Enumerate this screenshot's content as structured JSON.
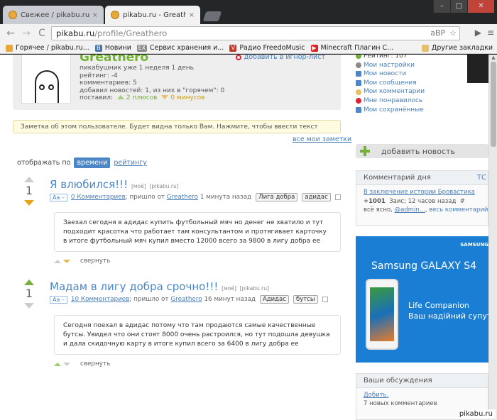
{
  "browser": {
    "tabs": [
      {
        "title": "Свежее / pikabu.ru - Все",
        "close": "×"
      },
      {
        "title": "pikabu.ru - Greathero",
        "close": "×"
      }
    ],
    "window_controls": {
      "minimize": "–",
      "maximize": "□",
      "close": "✕"
    },
    "url_host": "pikabu.ru",
    "url_path": "/profile/Greathero",
    "nav": {
      "back": "←",
      "forward": "→",
      "reload": "C"
    },
    "omni_icons": {
      "extension": "aBP",
      "star": "☆"
    },
    "toolbar_icons": {
      "extension": "▶",
      "menu": "≡"
    },
    "bookmarks": [
      {
        "label": "Горячее / pikabu.ru...",
        "icon": "pikabu-icon",
        "color": "#e8a93a",
        "glyph": ""
      },
      {
        "label": "Новини",
        "icon": "vk-icon",
        "color": "#4a76a8",
        "glyph": "B"
      },
      {
        "label": "Сервис хранения и...",
        "icon": "ex-icon",
        "color": "#8a8a8a",
        "glyph": "EX"
      },
      {
        "label": "Радио FreedoMusic",
        "icon": "radio-icon",
        "color": "#c0392b",
        "glyph": "V"
      },
      {
        "label": "Minecraft Плагин С...",
        "icon": "youtube-icon",
        "color": "#d22",
        "glyph": "▶"
      }
    ],
    "other_bookmarks": "Другие закладки"
  },
  "profile": {
    "username": "Greathero",
    "ignore_link": "добавить в игнор-лист",
    "stats": [
      "пикабушник уже 1 неделя 1 день",
      "рейтинг: -4",
      "комментариев: 5",
      "добавил новостей: 1, из них в \"горячем\": 0"
    ],
    "votes_label": "поставил:",
    "plus_votes": "2 плюсов",
    "minus_votes": "0 минусов"
  },
  "note": {
    "placeholder": "Заметка об этом пользователе. Будет видна только Вам. Нажмите, чтобы ввести текст",
    "all_notes": "все мои заметки"
  },
  "sort": {
    "label": "отображать по",
    "active": "времени",
    "other": "рейтингу"
  },
  "posts": [
    {
      "rating": "1",
      "title": "Я влюбился!!!",
      "mine": "[моё]",
      "source": "[pikabu.ru]",
      "font": "Аа –",
      "comments": "0 Комментариев",
      "meta": "; пришло от",
      "author": "Greathero",
      "time": "1 минута назад",
      "tags": [
        "Лига добра",
        "адидас"
      ],
      "body": "Заехал сегодня в адидас купить футбольный мяч но денег не хватило и тут подходит красотка что работает там консультантом и протягивает карточку в итоге футбольный мяч купил вместо 12000 всего за 9800 в лигу добра ее",
      "collapse": "свернуть"
    },
    {
      "rating": "1",
      "title": "Мадам в лигу добра срочно!!!",
      "mine": "[моё]",
      "source": "[pikabu.ru]",
      "font": "Аа –",
      "comments": "10 Комментариев",
      "meta": "; пришло от",
      "author": "Greathero",
      "time": "16 минут назад",
      "tags": [
        "Адидас",
        "бутсы"
      ],
      "body": "Сегодня поехал в адидас потому что там продаются самые качественные бутсы. Увидел что они стоят 8000 очень растроился, но тут подошла девушка и дала скидочную карту в итоге купил всего за 6400 в лигу добра ее",
      "collapse": "свернуть"
    }
  ],
  "sidebar": {
    "menu": [
      {
        "label": "Рейтинг: 107",
        "icon": "rating-icon",
        "color": "#76b03a"
      },
      {
        "label": "Мои настройки",
        "icon": "settings-icon",
        "color": "#8a8a8a"
      },
      {
        "label": "Мои новости",
        "icon": "news-icon",
        "color": "#4a86c8"
      },
      {
        "label": "Мои сообщения",
        "icon": "messages-icon",
        "color": "#4a86c8"
      },
      {
        "label": "Мои комментарии",
        "icon": "comments-icon",
        "color": "#e8c060"
      },
      {
        "label": "Мне понравилось",
        "icon": "heart-icon",
        "color": "#d23"
      },
      {
        "label": "Мои сохранённые",
        "icon": "saved-icon",
        "color": "#4a86c8"
      }
    ],
    "add_news": "добавить новость",
    "comment_of_day": {
      "header": "Комментарий дня",
      "header_right": "ТС",
      "story": "В заключение истории Бровастика",
      "score": "+1001",
      "author": "Заис",
      "time": "12 часов назад",
      "hash": "#",
      "text": "всё ясно,",
      "mention": "@admin...",
      "all": "весь комментарий"
    },
    "ad": {
      "brand": "SAMSUNG",
      "title": "Samsung GALAXY S4",
      "line1": "Life Companion",
      "line2": "Ваш надійний супут"
    },
    "discussions": {
      "header": "Ваши обсуждения",
      "link": "Добить.",
      "count": "7 новых комментариев"
    }
  },
  "watermark": "pikabu.ru",
  "colors": {
    "green": "#70b52c",
    "link": "#4a86c8",
    "accent": "#4c86c6"
  }
}
